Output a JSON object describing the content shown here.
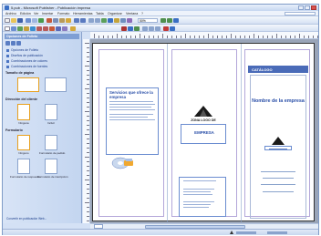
{
  "window": {
    "title": "5.pub - Microsoft Publisher - Publicación impresa"
  },
  "menu": {
    "items": [
      "Archivo",
      "Edición",
      "Ver",
      "Insertar",
      "Formato",
      "Herramientas",
      "Tabla",
      "Organizar",
      "Ventana",
      "?"
    ]
  },
  "toolbar": {
    "zoom": "50%"
  },
  "taskpane": {
    "title": "Opciones de Folleto",
    "links": [
      "Opciones de Folleto",
      "Diseños de publicación",
      "Combinaciones de colores",
      "Combinaciones de fuentes"
    ],
    "section_page_size": "Tamaño de página",
    "section_customer_address": "Dirección del cliente",
    "address_options": [
      "Ninguna",
      "Incluir"
    ],
    "section_form": "Formulario",
    "form_options": [
      "Ninguno",
      "Formulario de pedido",
      "Formulario de respuesta",
      "Formulario de inscripción"
    ],
    "footer_link": "Convertir en publicación Web..."
  },
  "document": {
    "services_heading": "Servicios que ofrece la empresa",
    "logo_zone": "ZONA LOGO DE",
    "logo_company": "EMPRESA",
    "catalog_label": "CATÁLOGO",
    "company_name": "Nombre de la empresa"
  },
  "colors": {
    "chrome": "#d4e1f5",
    "catalog_bar": "#4a6bb8",
    "text_blue": "#2a4fa8"
  }
}
